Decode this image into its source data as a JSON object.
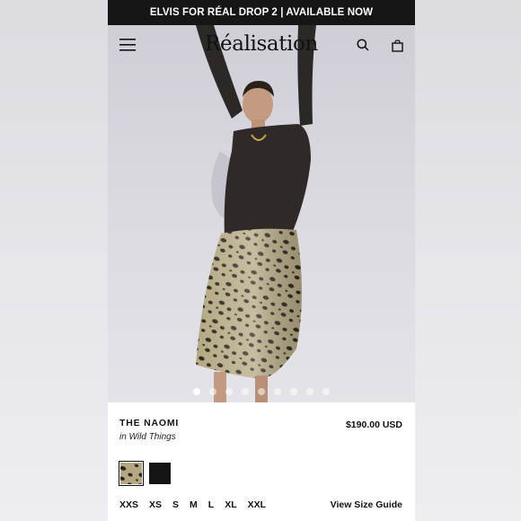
{
  "announcement": {
    "text": "ELVIS FOR RÉAL DROP 2 | AVAILABLE NOW"
  },
  "header": {
    "logo": "Réalisation",
    "menu_icon": "hamburger-menu-icon",
    "search_icon": "search-icon",
    "bag_icon": "shopping-bag-icon"
  },
  "gallery": {
    "image_alt": "Model wearing a black long-sleeve bodysuit and leopard print satin midi skirt, arms raised",
    "slide_count": 9,
    "active_slide": 1
  },
  "product": {
    "name": "THE NAOMI",
    "collection": "in Wild Things",
    "price": "$190.00 USD",
    "swatches": [
      {
        "name": "leopard",
        "selected": true
      },
      {
        "name": "black",
        "selected": false
      }
    ],
    "sizes": [
      "XXS",
      "XS",
      "S",
      "M",
      "L",
      "XL",
      "XXL"
    ],
    "size_guide_label": "View Size Guide"
  },
  "colors": {
    "announcement_bg": "#161616",
    "text": "#111111",
    "background": "#ffffff"
  }
}
